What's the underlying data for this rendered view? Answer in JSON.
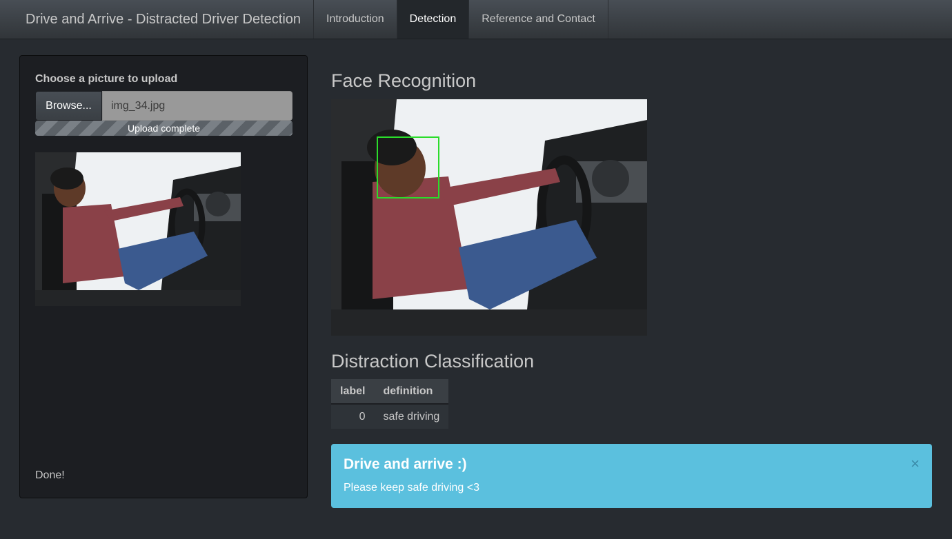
{
  "navbar": {
    "brand": "Drive and Arrive - Distracted Driver Detection",
    "tabs": [
      {
        "label": "Introduction"
      },
      {
        "label": "Detection"
      },
      {
        "label": "Reference and Contact"
      }
    ],
    "active_tab": "Detection"
  },
  "sidebar": {
    "upload_label": "Choose a picture to upload",
    "browse_label": "Browse...",
    "file_name": "img_34.jpg",
    "progress_text": "Upload complete",
    "progress_fraction": 1.0,
    "status_text": "Done!"
  },
  "main": {
    "face_heading": "Face Recognition",
    "classification_heading": "Distraction Classification",
    "table": {
      "headers": [
        "label",
        "definition"
      ],
      "rows": [
        [
          "0",
          "safe driving"
        ]
      ]
    },
    "alert": {
      "title": "Drive and arrive :)",
      "body": "Please keep safe driving <3",
      "close_symbol": "×"
    }
  },
  "colors": {
    "background": "#272b30",
    "panel": "#1c1e22",
    "alert_info": "#5bc0de",
    "face_box": "#2bdc2b"
  }
}
